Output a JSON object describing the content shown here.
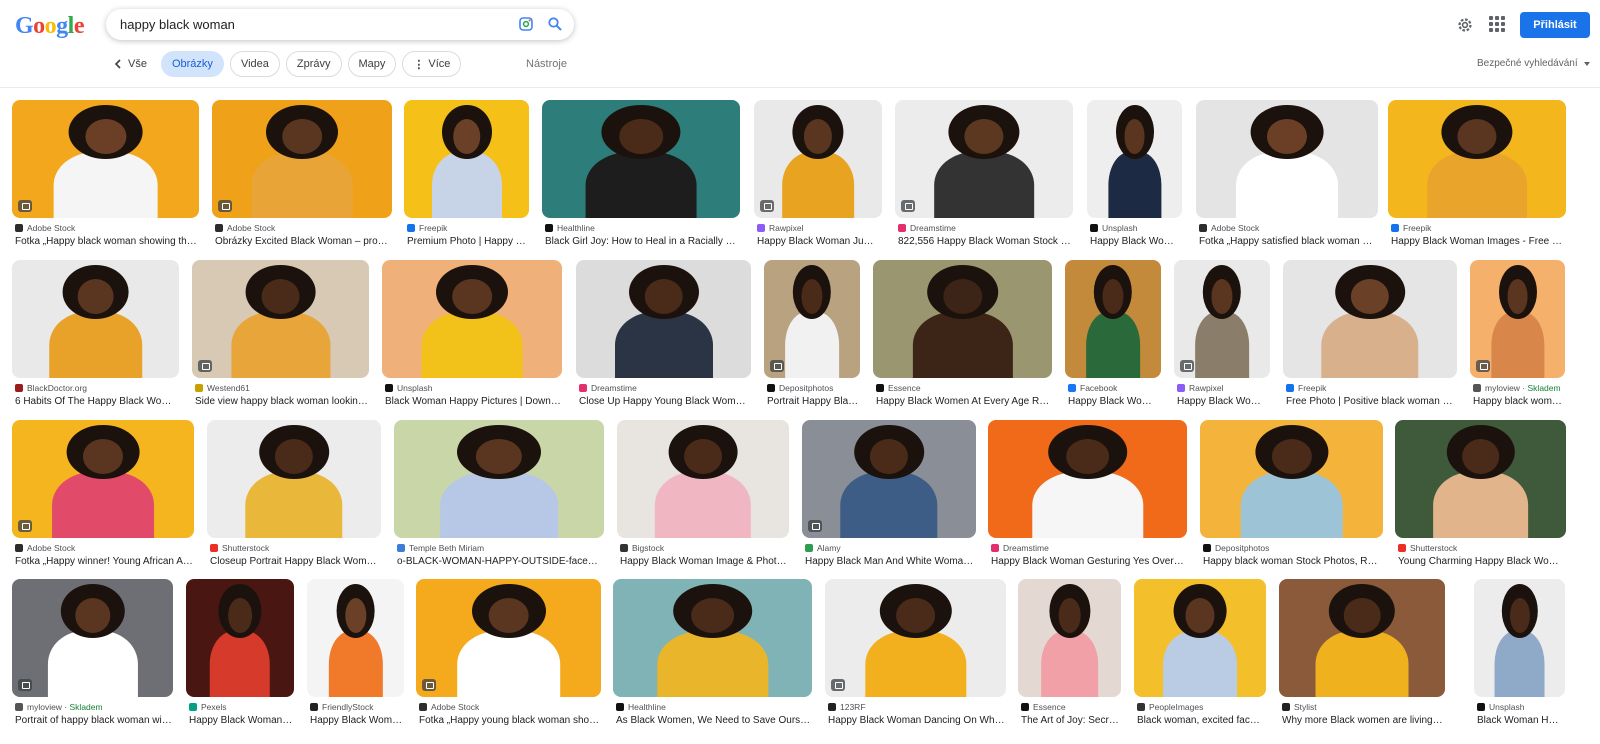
{
  "header": {
    "logo_letters": [
      {
        "ch": "G",
        "color": "#4285f4"
      },
      {
        "ch": "o",
        "color": "#ea4335"
      },
      {
        "ch": "o",
        "color": "#fbbc05"
      },
      {
        "ch": "g",
        "color": "#4285f4"
      },
      {
        "ch": "l",
        "color": "#34a853"
      },
      {
        "ch": "e",
        "color": "#ea4335"
      }
    ],
    "search_query": "happy black woman",
    "sign_in_label": "Přihlásit"
  },
  "tabs": {
    "back_label": "Vše",
    "items": [
      "Obrázky",
      "Videa",
      "Zprávy",
      "Mapy",
      "Více"
    ],
    "tools_label": "Nástroje",
    "safesearch_label": "Bezpečné vyhledávání"
  },
  "results": [
    {
      "source": "Adobe Stock",
      "title": "Fotka „Happy black woman showing thu...",
      "bg": "#f2a71c",
      "skin": "#6b3f25",
      "cloth": "#f5f5f5",
      "fav": "#2d2d2d",
      "badge": true
    },
    {
      "source": "Adobe Stock",
      "title": "Obrázky Excited Black Woman – proch...",
      "bg": "#efa219",
      "skin": "#5a3520",
      "cloth": "#e9a437",
      "fav": "#2d2d2d",
      "badge": true
    },
    {
      "source": "Freepik",
      "title": "Premium Photo | Happy ch...",
      "bg": "#f5c018",
      "skin": "#6a4027",
      "cloth": "#c7d3e6",
      "fav": "#1273eb",
      "badge": false
    },
    {
      "source": "Healthline",
      "title": "Black Girl Joy: How to Heal in a Racially Unj...",
      "bg": "#2d7d7b",
      "skin": "#4a2a18",
      "cloth": "#1d1d1d",
      "fav": "#111111",
      "badge": false
    },
    {
      "source": "Rawpixel",
      "title": "Happy Black Woman Jumpi...",
      "bg": "#e9e9e9",
      "skin": "#5a3520",
      "cloth": "#e8a420",
      "fav": "#8b5cf6",
      "badge": true
    },
    {
      "source": "Dreamstime",
      "title": "822,556 Happy Black Woman Stock Ph...",
      "bg": "#ececec",
      "skin": "#5d3821",
      "cloth": "#333333",
      "fav": "#e1306c",
      "badge": true
    },
    {
      "source": "Unsplash",
      "title": "Happy Black Woma...",
      "bg": "#eeeeee",
      "skin": "#5a3520",
      "cloth": "#1d2a44",
      "fav": "#111111",
      "badge": false
    },
    {
      "source": "Adobe Stock",
      "title": "Fotka „Happy satisfied black woman sh...",
      "bg": "#e4e4e4",
      "skin": "#6b3f25",
      "cloth": "#ffffff",
      "fav": "#2d2d2d",
      "badge": false
    },
    {
      "source": "Freepik",
      "title": "Happy Black Woman Images - Free Do...",
      "bg": "#f3b71d",
      "skin": "#5a3520",
      "cloth": "#e9a52b",
      "fav": "#1273eb",
      "badge": false
    },
    {
      "source": "BlackDoctor.org",
      "title": "6 Habits Of The Happy Black Woman...",
      "bg": "#e9e9e9",
      "skin": "#5a3520",
      "cloth": "#e8a22a",
      "fav": "#9b1c1c",
      "badge": false
    },
    {
      "source": "Westend61",
      "title": "Side view happy black woman looking ...",
      "bg": "#d8c9b5",
      "skin": "#4a2a18",
      "cloth": "#e7a53a",
      "fav": "#c8a000",
      "badge": true
    },
    {
      "source": "Unsplash",
      "title": "Black Woman Happy Pictures | Downloa...",
      "bg": "#f0b07a",
      "skin": "#5a3520",
      "cloth": "#f2c21b",
      "fav": "#111111",
      "badge": false
    },
    {
      "source": "Dreamstime",
      "title": "Close Up Happy Young Black Woman ...",
      "bg": "#dcdcdc",
      "skin": "#4a2a18",
      "cloth": "#2b3445",
      "fav": "#e1306c",
      "badge": false
    },
    {
      "source": "Depositphotos",
      "title": "Portrait Happy Blac...",
      "bg": "#b8a27f",
      "skin": "#4a2a18",
      "cloth": "#f1f1f1",
      "fav": "#111111",
      "badge": true
    },
    {
      "source": "Essence",
      "title": "Happy Black Women At Every Age Reve...",
      "bg": "#9a9670",
      "skin": "#3c2416",
      "cloth": "#3c2416",
      "fav": "#111111",
      "badge": false
    },
    {
      "source": "Facebook",
      "title": "Happy Black Woman",
      "bg": "#c48a3c",
      "skin": "#4a2a18",
      "cloth": "#2a6a3a",
      "fav": "#1877f2",
      "badge": false
    },
    {
      "source": "Rawpixel",
      "title": "Happy Black Woma...",
      "bg": "#e9e9e9",
      "skin": "#5a3520",
      "cloth": "#8a7e6a",
      "fav": "#8b5cf6",
      "badge": true
    },
    {
      "source": "Freepik",
      "title": "Free Photo | Positive black woman wit...",
      "bg": "#e5e5e5",
      "skin": "#6a4027",
      "cloth": "#d9b08c",
      "fav": "#1273eb",
      "badge": false
    },
    {
      "source": "myloview · Skladem",
      "title": "Happy black woma...",
      "bg": "#f5b16b",
      "skin": "#5a3520",
      "cloth": "#d9864a",
      "fav": "#555555",
      "badge": true,
      "instock": true
    },
    {
      "source": "Adobe Stock",
      "title": "Fotka „Happy winner! Young African Am...",
      "bg": "#f5b51e",
      "skin": "#5a3520",
      "cloth": "#e24a6a",
      "fav": "#2d2d2d",
      "badge": true
    },
    {
      "source": "Shutterstock",
      "title": "Closeup Portrait Happy Black Woman ...",
      "bg": "#ececec",
      "skin": "#4a2a18",
      "cloth": "#e9b83a",
      "fav": "#ee2e24",
      "badge": false
    },
    {
      "source": "Temple Beth Miriam",
      "title": "o-BLACK-WOMAN-HAPPY-OUTSIDE-facebook ...",
      "bg": "#c9d7a8",
      "skin": "#5a3520",
      "cloth": "#b7c7e6",
      "fav": "#3b7dd8",
      "badge": false
    },
    {
      "source": "Bigstock",
      "title": "Happy Black Woman Image & Photo (...",
      "bg": "#e8e4df",
      "skin": "#4a2a18",
      "cloth": "#f0b7c3",
      "fav": "#333333",
      "badge": false
    },
    {
      "source": "Alamy",
      "title": "Happy Black Man And White Woman T...",
      "bg": "#8a8f97",
      "skin": "#4a2a18",
      "cloth": "#3d5c86",
      "fav": "#2e9d4f",
      "badge": true
    },
    {
      "source": "Dreamstime",
      "title": "Happy Black Woman Gesturing Yes Over Or...",
      "bg": "#f06a1a",
      "skin": "#4a2a18",
      "cloth": "#f6f6f6",
      "fav": "#e1306c",
      "badge": false
    },
    {
      "source": "Depositphotos",
      "title": "Happy black woman Stock Photos, Roya...",
      "bg": "#f4b33a",
      "skin": "#4a2a18",
      "cloth": "#9dc3d6",
      "fav": "#111111",
      "badge": false
    },
    {
      "source": "Shutterstock",
      "title": "Young Charming Happy Black Woman ...",
      "bg": "#3f5a3a",
      "skin": "#4a2a18",
      "cloth": "#e2b48c",
      "fav": "#ee2e24",
      "badge": false
    },
    {
      "source": "myloview · Skladem",
      "title": "Portrait of happy black woman wit...",
      "bg": "#6d6f75",
      "skin": "#5a3520",
      "cloth": "#ffffff",
      "fav": "#555555",
      "badge": true,
      "instock": true
    },
    {
      "source": "Pexels",
      "title": "Happy Black Woman P...",
      "bg": "#4a1612",
      "skin": "#4a2a18",
      "cloth": "#d63a2a",
      "fav": "#05a081",
      "badge": false
    },
    {
      "source": "FriendlyStock",
      "title": "Happy Black Woma...",
      "bg": "#f4f4f4",
      "skin": "#6a4027",
      "cloth": "#f07a2a",
      "fav": "#222222",
      "badge": false
    },
    {
      "source": "Adobe Stock",
      "title": "Fotka „Happy young black woman showi...",
      "bg": "#f5a91c",
      "skin": "#5a3520",
      "cloth": "#ffffff",
      "fav": "#2d2d2d",
      "badge": true
    },
    {
      "source": "Healthline",
      "title": "As Black Women, We Need to Save Ourselve...",
      "bg": "#7fb3b5",
      "skin": "#4a2a18",
      "cloth": "#e9b52a",
      "fav": "#111111",
      "badge": false
    },
    {
      "source": "123RF",
      "title": "Happy Black Woman Dancing On White ...",
      "bg": "#ececec",
      "skin": "#4a2a18",
      "cloth": "#f2b01e",
      "fav": "#222222",
      "badge": true
    },
    {
      "source": "Essence",
      "title": "The Art of Joy: Secre...",
      "bg": "#e3d8d2",
      "skin": "#4a2a18",
      "cloth": "#f0a0a6",
      "fav": "#111111",
      "badge": false
    },
    {
      "source": "PeopleImages",
      "title": "Black woman, excited face ...",
      "bg": "#f3bf2a",
      "skin": "#5a3520",
      "cloth": "#b9cce4",
      "fav": "#333333",
      "badge": false
    },
    {
      "source": "Stylist",
      "title": "Why more Black women are living the '...",
      "bg": "#8a5a3a",
      "skin": "#4a2a18",
      "cloth": "#efb21e",
      "fav": "#222222",
      "badge": false
    },
    {
      "source": "Unsplash",
      "title": "Black Woman Happ...",
      "bg": "#ececec",
      "skin": "#4a2a18",
      "cloth": "#8fa9c8",
      "fav": "#111111",
      "badge": false
    }
  ]
}
